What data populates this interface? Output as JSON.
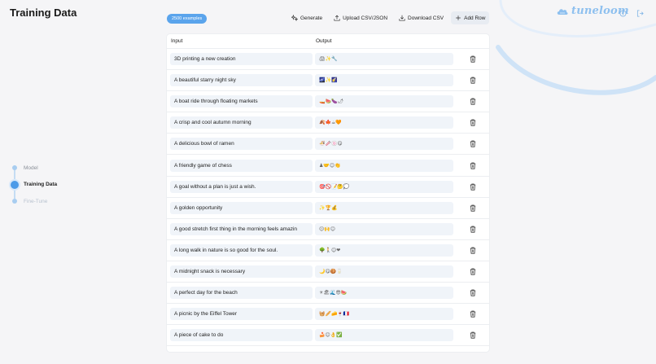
{
  "page": {
    "title": "Training Data"
  },
  "stepper": {
    "steps": [
      {
        "label": "Model",
        "state": "done"
      },
      {
        "label": "Training Data",
        "state": "active"
      },
      {
        "label": "Fine-Tune",
        "state": "disabled"
      }
    ]
  },
  "toolbar": {
    "badge": "2500 examples",
    "generate": "Generate",
    "upload": "Upload CSV/JSON",
    "download": "Download CSV",
    "add_row": "Add Row"
  },
  "brand": {
    "name": "tuneloom",
    "color": "#8ec0ef"
  },
  "table": {
    "headers": {
      "input": "Input",
      "output": "Output"
    },
    "rows": [
      {
        "input": "3D printing a new creation",
        "output": "🖨✨🔧"
      },
      {
        "input": "A beautiful starry night sky",
        "output": "🌌✨🌠"
      },
      {
        "input": "A boat ride through floating markets",
        "output": "🚤🍉🍆🌶"
      },
      {
        "input": "A crisp and cool autumn morning",
        "output": "🍂🍁☕🧡"
      },
      {
        "input": "A delicious bowl of ramen",
        "output": "🍜🥢🍥😋"
      },
      {
        "input": "A friendly game of chess",
        "output": "♟🤝😊👏"
      },
      {
        "input": "A goal without a plan is just a wish.",
        "output": "🎯🚫📝🤔💭"
      },
      {
        "input": "A golden opportunity",
        "output": "✨🏆💰"
      },
      {
        "input": "A good stretch first thing in the morning feels amazin",
        "output": "😌🙌😊"
      },
      {
        "input": "A long walk in nature is so good for the soul.",
        "output": "🌳🚶😊❤"
      },
      {
        "input": "A midnight snack is necessary",
        "output": "🌙😋🍪🥛"
      },
      {
        "input": "A perfect day for the beach",
        "output": "☀🏖🌊😎🍉"
      },
      {
        "input": "A picnic by the Eiffel Tower",
        "output": "🧺🥖🧀🍷🇫🇷"
      },
      {
        "input": "A piece of cake to do",
        "output": "🍰😊👌✅"
      }
    ]
  }
}
